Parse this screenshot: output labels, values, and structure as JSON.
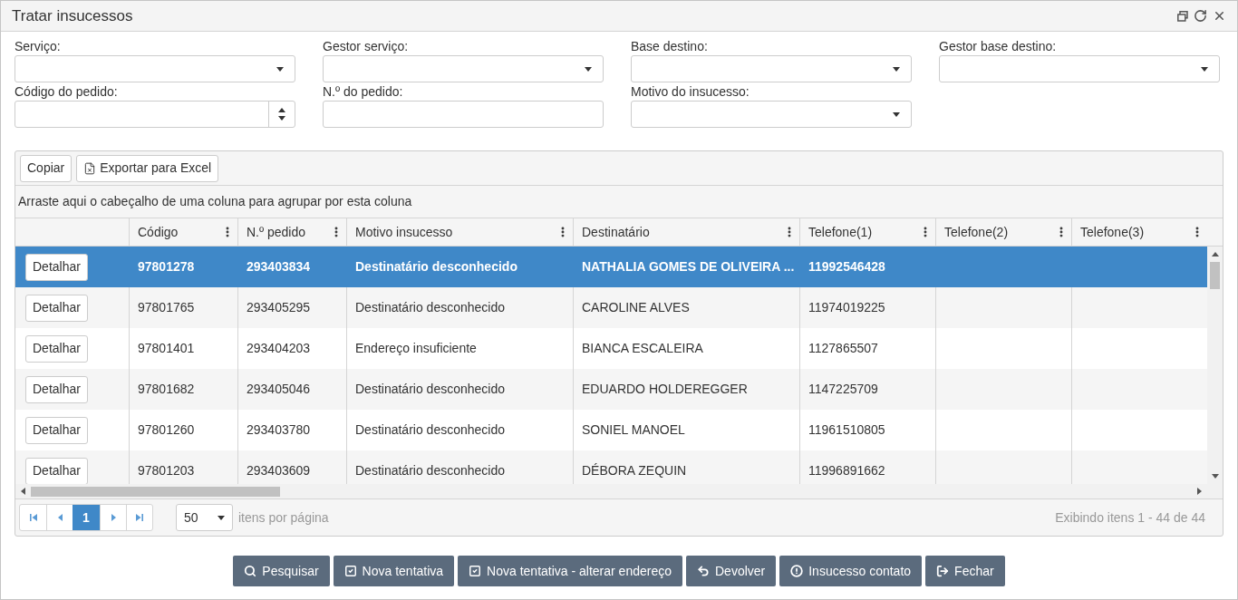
{
  "window": {
    "title": "Tratar insucessos"
  },
  "filters": [
    {
      "label": "Serviço:",
      "kind": "select"
    },
    {
      "label": "Gestor serviço:",
      "kind": "select"
    },
    {
      "label": "Base destino:",
      "kind": "select"
    },
    {
      "label": "Gestor base destino:",
      "kind": "select"
    },
    {
      "label": "Código do pedido:",
      "kind": "number"
    },
    {
      "label": "N.º do pedido:",
      "kind": "text"
    },
    {
      "label": "Motivo do insucesso:",
      "kind": "select"
    }
  ],
  "grid": {
    "toolbar": [
      {
        "label": "Copiar",
        "kind": "plain"
      },
      {
        "label": "Exportar para Excel",
        "kind": "excel"
      }
    ],
    "group_hint": "Arraste aqui o cabeçalho de uma coluna para agrupar por esta coluna",
    "columns": [
      "",
      "Código",
      "N.º pedido",
      "Motivo insucesso",
      "Destinatário",
      "Telefone(1)",
      "Telefone(2)",
      "Telefone(3)"
    ],
    "rows": [
      {
        "selected": true,
        "cells": [
          "Detalhar",
          "97801278",
          "293403834",
          "Destinatário desconhecido",
          "NATHALIA GOMES DE OLIVEIRA ...",
          "11992546428",
          "",
          ""
        ]
      },
      {
        "selected": false,
        "cells": [
          "Detalhar",
          "97801765",
          "293405295",
          "Destinatário desconhecido",
          "CAROLINE ALVES",
          "11974019225",
          "",
          ""
        ]
      },
      {
        "selected": false,
        "cells": [
          "Detalhar",
          "97801401",
          "293404203",
          "Endereço insuficiente",
          "BIANCA ESCALEIRA",
          "1127865507",
          "",
          ""
        ]
      },
      {
        "selected": false,
        "cells": [
          "Detalhar",
          "97801682",
          "293405046",
          "Destinatário desconhecido",
          "EDUARDO HOLDEREGGER",
          "1147225709",
          "",
          ""
        ]
      },
      {
        "selected": false,
        "cells": [
          "Detalhar",
          "97801260",
          "293403780",
          "Destinatário desconhecido",
          "SONIEL MANOEL",
          "11961510805",
          "",
          ""
        ]
      },
      {
        "selected": false,
        "cells": [
          "Detalhar",
          "97801203",
          "293403609",
          "Destinatário desconhecido",
          "DÉBORA ZEQUIN",
          "11996891662",
          "",
          ""
        ]
      }
    ],
    "pager": {
      "pages": [
        {
          "label": "1",
          "selected": true
        }
      ],
      "page_size": "50",
      "page_size_label": "itens por página",
      "summary": "Exibindo itens 1 - 44 de 44"
    }
  },
  "actions": [
    {
      "label": "Pesquisar",
      "kind": "search"
    },
    {
      "label": "Nova tentativa",
      "kind": "retry"
    },
    {
      "label": "Nova tentativa - alterar endereço",
      "kind": "retry"
    },
    {
      "label": "Devolver",
      "kind": "return"
    },
    {
      "label": "Insucesso contato",
      "kind": "alert"
    },
    {
      "label": "Fechar",
      "kind": "exit"
    }
  ]
}
